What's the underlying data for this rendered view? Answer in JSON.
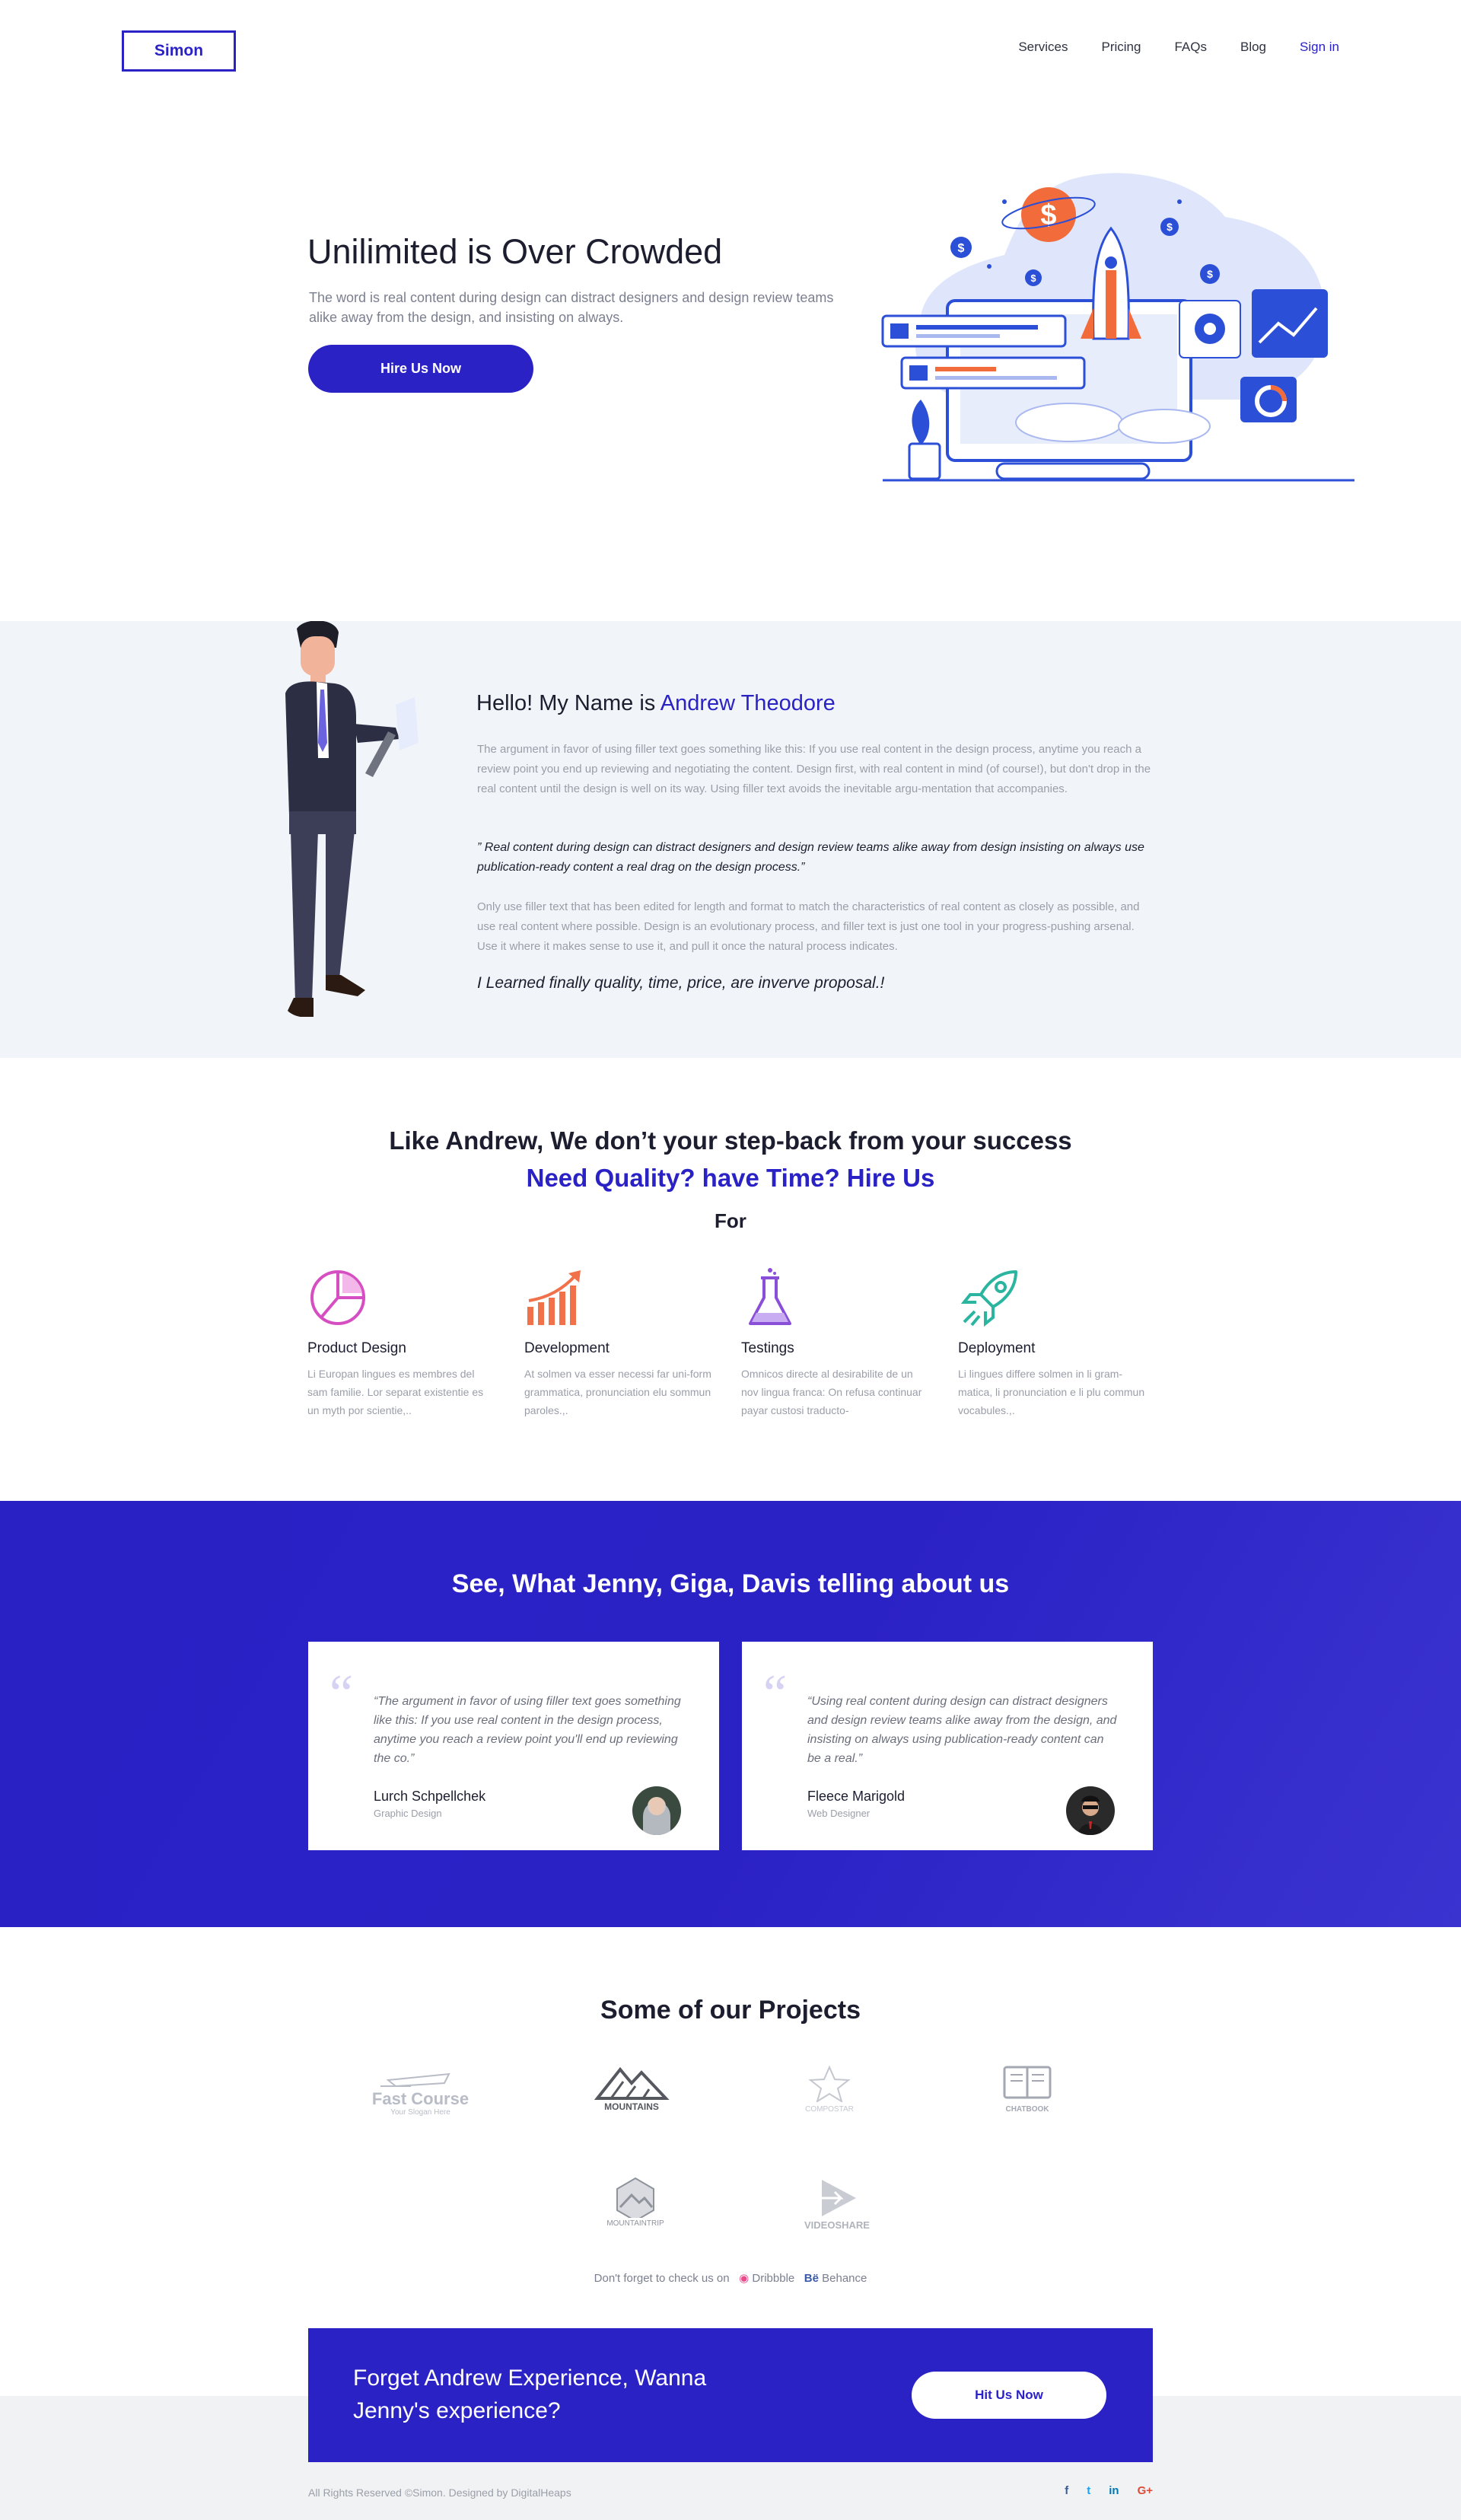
{
  "header": {
    "logo": "Simon",
    "nav": [
      "Services",
      "Pricing",
      "FAQs",
      "Blog"
    ],
    "signin": "Sign in"
  },
  "hero": {
    "title": "Unilimited is Over Crowded",
    "subtitle": "The word is real content during design can distract designers and design review teams alike away from the design, and insisting on always.",
    "button": "Hire Us Now"
  },
  "about": {
    "title_prefix": "Hello! My Name is ",
    "title_name": "Andrew Theodore",
    "p1": "The argument in favor of using filler text goes something like this: If you use real content in the design process, anytime you reach a review point you end up reviewing and negotiating the content. Design first, with real content in mind (of course!), but don't drop in the real content until the design is well on its way. Using filler text avoids the inevitable argu-mentation that accompanies.",
    "quote": "” Real content during design can distract designers and design review teams alike away from design insisting on always use publication-ready content a real drag on the design process.”",
    "p2": "Only use filler text that has been edited for length and format to match the characteristics of real content as closely as possible, and use real content where possible. Design is an evolutionary process, and filler text is just one tool in your progress-pushing arsenal. Use it where it makes sense to use it, and pull it once the natural process indicates.",
    "sign": "I Learned finally quality, time, price, are inverve proposal.!"
  },
  "services": {
    "heading1": "Like Andrew, We don’t your step-back from your success",
    "heading2": "Need Quality? have Time? Hire Us",
    "heading3": "For",
    "items": [
      {
        "name": "Product Design",
        "desc": "Li Europan lingues es membres del sam familie. Lor separat existentie es un myth por scientie,..",
        "icon": "pie-chart-icon"
      },
      {
        "name": "Development",
        "desc": "At solmen va esser necessi far uni-form grammatica, pronunciation elu sommun paroles.,.",
        "icon": "growth-chart-icon"
      },
      {
        "name": "Testings",
        "desc": "Omnicos directe al desirabilite de un nov lingua franca: On refusa continuar payar custosi traducto-",
        "icon": "flask-icon"
      },
      {
        "name": "Deployment",
        "desc": "Li lingues differe solmen in li gram-matica, li pronunciation e li plu commun vocabules.,.",
        "icon": "rocket-icon"
      }
    ]
  },
  "testimonials": {
    "title": "See, What Jenny, Giga, Davis telling about us",
    "items": [
      {
        "text": "“The argument in favor of using filler text goes something like this: If you use real content in the design process, anytime you reach a review point you'll end up reviewing the co.”",
        "name": "Lurch Schpellchek",
        "role": "Graphic Design"
      },
      {
        "text": "“Using real content during design can distract designers and design review teams alike away from the design, and insisting on always using publication-ready content can be a real.”",
        "name": "Fleece Marigold",
        "role": "Web Designer"
      }
    ]
  },
  "projects": {
    "title": "Some of our Projects",
    "logos": [
      {
        "name": "Fast Course",
        "tagline": "Your Slogan Here"
      },
      {
        "name": "MOUNTAINS"
      },
      {
        "name": "COMPOSTAR"
      },
      {
        "name": "CHATBOOK"
      },
      {
        "name": "MOUNTAINTRIP"
      },
      {
        "name": "VIDEOSHARE"
      }
    ],
    "check_prefix": "Don't forget to check us on",
    "dribbble": "Dribbble",
    "behance_icon": "Bë",
    "behance": "Behance"
  },
  "cta": {
    "text": "Forget Andrew Experience, Wanna Jenny's experience?",
    "button": "Hit Us Now"
  },
  "footer": {
    "copyright": "All Rights Reserved ©Simon. Designed by DigitalHeaps",
    "social": [
      "f",
      "t",
      "in",
      "G+"
    ]
  },
  "colors": {
    "brand": "#2b22c6",
    "text": "#1c1d2e",
    "muted": "#9a9ea8"
  }
}
